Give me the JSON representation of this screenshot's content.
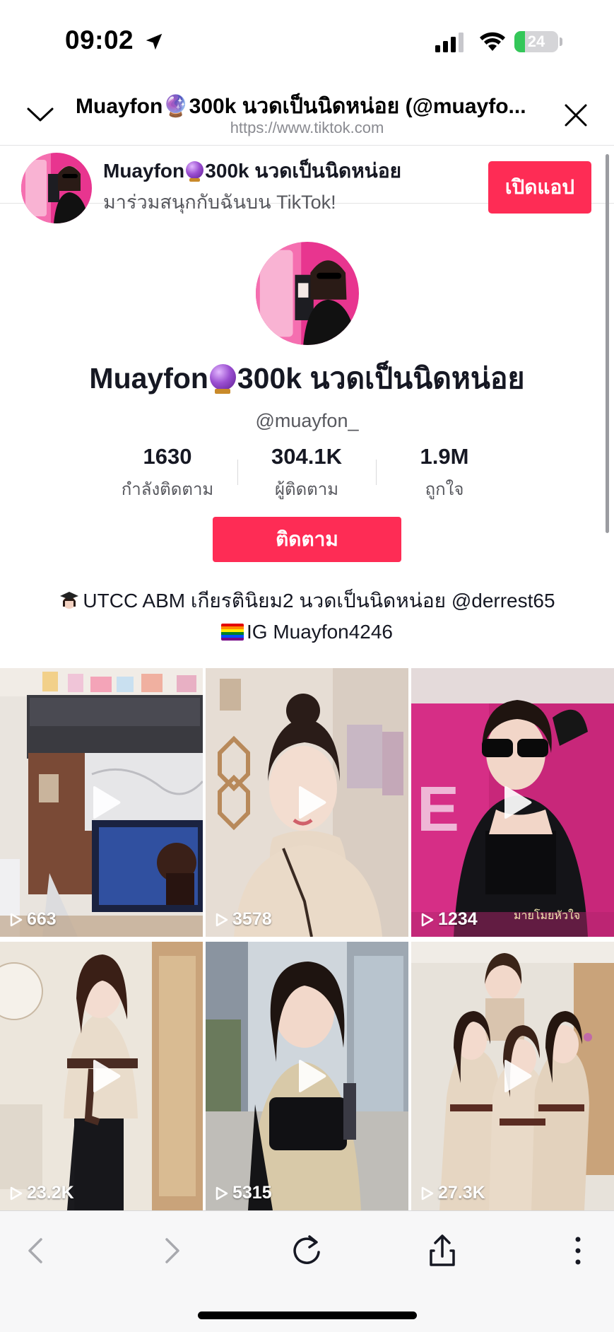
{
  "status_bar": {
    "time": "09:02",
    "battery": "24",
    "battery_color": "#34c759"
  },
  "browser": {
    "page_title": "Muayfon🔮300k นวดเป็นนิดหน่อย (@muayfo...",
    "url": "https://www.tiktok.com",
    "icons": [
      "chevron-down-icon",
      "close-icon"
    ]
  },
  "app_banner": {
    "name_prefix": "Muayfon",
    "name_suffix": "300k นวดเป็นนิดหน่อย",
    "subtitle": "มาร่วมสนุกกับฉันบน TikTok!",
    "open_app_label": "เปิดแอป"
  },
  "profile": {
    "name_prefix": "Muayfon",
    "name_suffix": "300k นวดเป็นนิดหน่อย",
    "username": "@muayfon_",
    "stats": [
      {
        "value": "1630",
        "label": "กำลังติดตาม"
      },
      {
        "value": "304.1K",
        "label": "ผู้ติดตาม"
      },
      {
        "value": "1.9M",
        "label": "ถูกใจ"
      }
    ],
    "follow_label": "ติดตาม",
    "bio_line1": "UTCC ABM เกียรตินิยม2 นวดเป็นนิดหน่อย @derrest65",
    "bio_line2": "IG Muayfon4246"
  },
  "videos": [
    {
      "views": "663"
    },
    {
      "views": "3578"
    },
    {
      "views": "1234"
    },
    {
      "views": "23.2K"
    },
    {
      "views": "5315"
    },
    {
      "views": "27.3K"
    }
  ],
  "video_overlay_texts": {
    "v3_caption": "มายโมยหัวใจ"
  },
  "toolbar": {
    "icons": [
      "back-icon",
      "forward-icon",
      "reload-icon",
      "share-icon",
      "more-icon"
    ]
  },
  "colors": {
    "accent": "#fe2c55",
    "text_primary": "#161823",
    "text_secondary": "#57585e"
  }
}
